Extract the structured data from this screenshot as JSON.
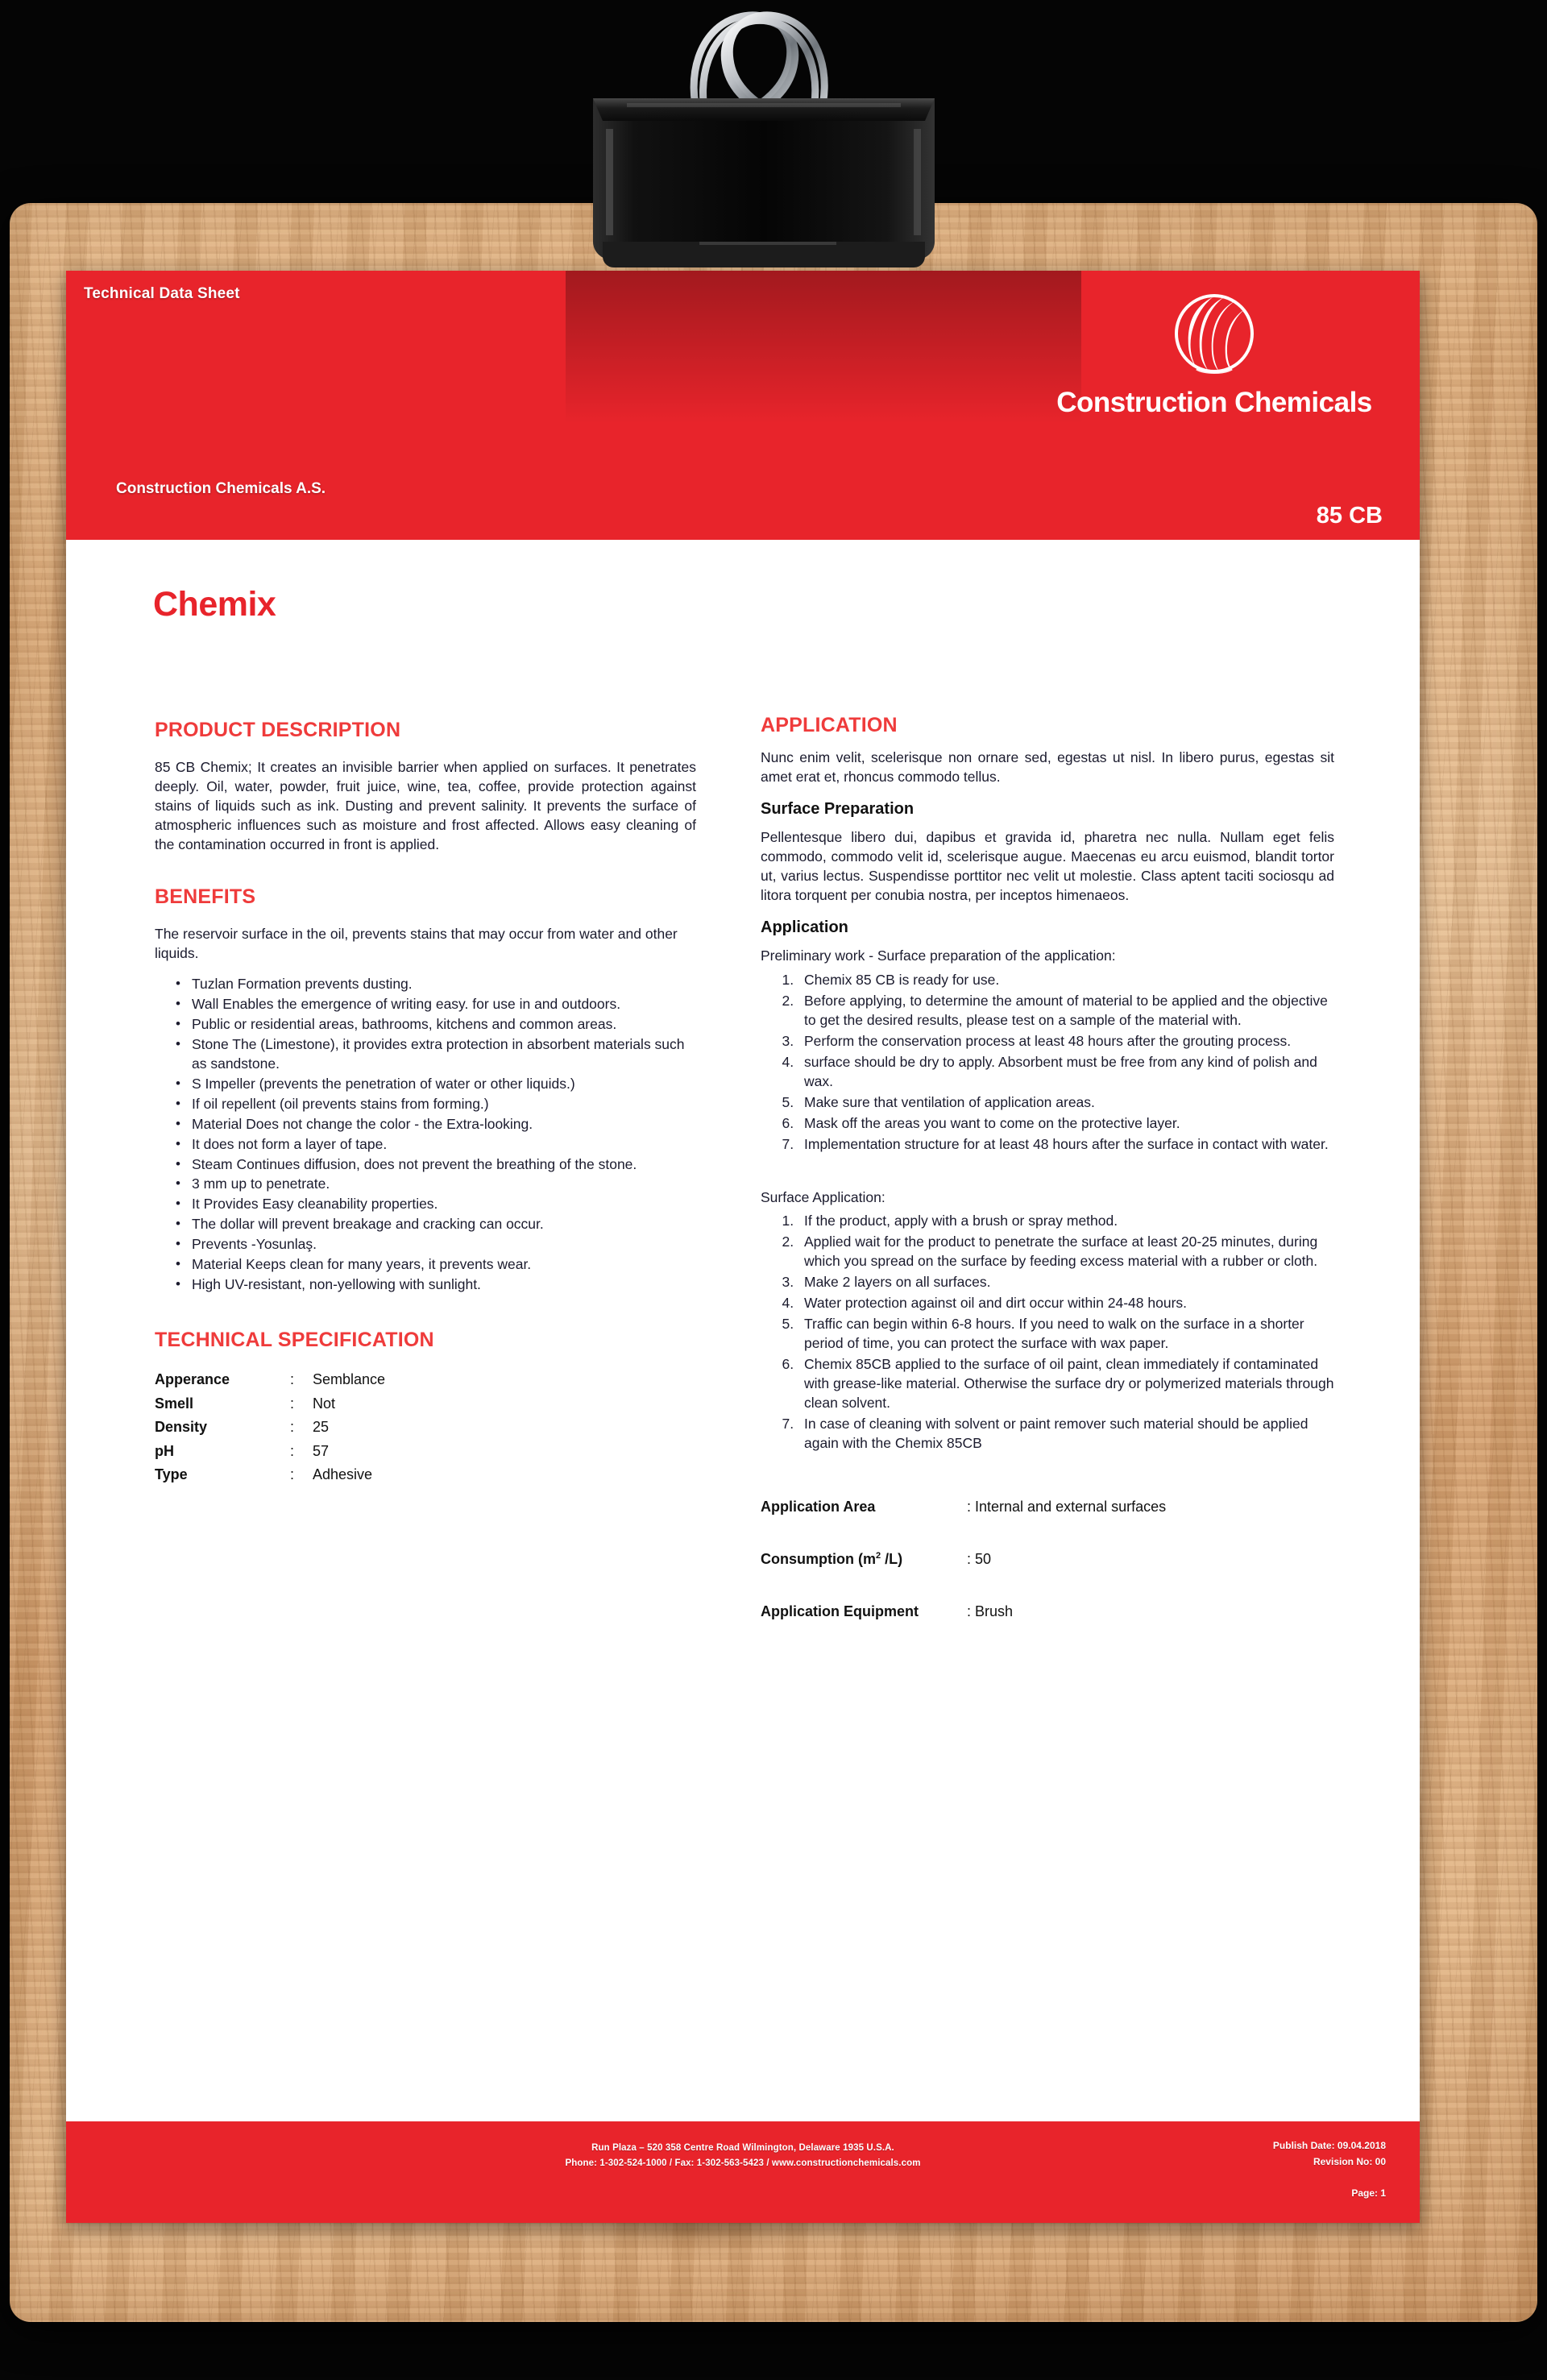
{
  "header": {
    "doc_label": "Technical Data Sheet",
    "company": "Construction Chemicals A.S.",
    "brand_name": "Construction Chemicals",
    "logo_icon": "globe-sphere-icon",
    "product_code": "85 CB"
  },
  "document": {
    "title": "Chemix"
  },
  "product_description": {
    "heading": "PRODUCT DESCRIPTION",
    "body": "85 CB Chemix; It creates an invisible barrier when applied on surfaces. It penetrates deeply. Oil, water, powder, fruit juice, wine, tea, coffee, provide protection against stains of liquids such as ink. Dusting and prevent salinity. It prevents the surface of atmospheric influences such as moisture and frost affected. Allows easy cleaning of the contamination occurred in front is applied."
  },
  "benefits": {
    "heading": "BENEFITS",
    "intro": "The reservoir surface in the oil, prevents stains that may occur from water and other liquids.",
    "items": [
      "Tuzlan Formation prevents dusting.",
      "Wall Enables the emergence of writing easy. for use in and outdoors.",
      "Public or residential areas, bathrooms, kitchens and common areas.",
      "Stone The (Limestone), it provides extra protection in absorbent materials such as sandstone.",
      "S Impeller (prevents the penetration of water or other liquids.)",
      "If oil repellent (oil prevents stains from forming.)",
      "Material Does not change the color - the Extra-looking.",
      "It does not form a layer of tape.",
      "Steam Continues diffusion, does not prevent the breathing of the stone.",
      "3 mm up to penetrate.",
      "It Provides Easy cleanability properties.",
      "The dollar will prevent breakage and cracking can occur.",
      "Prevents -Yosunlaş.",
      "Material Keeps clean for many years, it prevents wear.",
      "High UV-resistant, non-yellowing with sunlight."
    ]
  },
  "technical_specification": {
    "heading": "TECHNICAL SPECIFICATION",
    "rows": [
      {
        "key": "Apperance",
        "sep": ":",
        "value": "Semblance"
      },
      {
        "key": "Smell",
        "sep": ":",
        "value": "Not"
      },
      {
        "key": "Density",
        "sep": ":",
        "value": "25"
      },
      {
        "key": "pH",
        "sep": ":",
        "value": "57"
      },
      {
        "key": "Type",
        "sep": ":",
        "value": "Adhesive"
      }
    ]
  },
  "application": {
    "heading": "APPLICATION",
    "intro": "Nunc enim velit, scelerisque non ornare sed, egestas ut nisl. In libero purus, egestas sit amet erat et, rhoncus commodo tellus.",
    "surface_preparation": {
      "heading": "Surface Preparation",
      "body": "Pellentesque libero dui, dapibus et gravida id, pharetra nec nulla. Nullam eget felis commodo, commodo velit id, scelerisque augue. Maecenas eu arcu euismod, blandit tortor ut, varius lectus. Suspendisse porttitor nec velit ut molestie. Class aptent taciti sociosqu ad litora torquent per conubia nostra, per inceptos himenaeos."
    },
    "application_steps": {
      "heading": "Application",
      "lead": "Preliminary work - Surface preparation of the application:",
      "items": [
        "Chemix 85 CB is ready for use.",
        "Before applying, to determine the amount of material to be applied and the objective to get the desired results, please test on a sample of the material with.",
        "Perform the conservation process at least 48 hours after the grouting process.",
        "surface should be dry to apply. Absorbent must be free from any kind of polish and wax.",
        "Make sure that ventilation of application areas.",
        "Mask off the areas you want to come on the protective layer.",
        "Implementation structure for at least 48 hours after the surface in contact with water."
      ]
    },
    "surface_application": {
      "lead": "Surface Application:",
      "items": [
        "If the product, apply with a brush or spray method.",
        "Applied wait for the product to penetrate the surface at least 20-25 minutes, during which you spread on the surface by feeding excess material with a rubber or cloth.",
        "Make 2 layers on all surfaces.",
        "Water protection against oil and dirt occur within 24-48 hours.",
        "Traffic can begin within 6-8 hours. If you need to walk on the surface in a shorter period of time, you can protect the surface with wax paper.",
        "Chemix 85CB applied to the surface of oil paint, clean immediately if contaminated with grease-like material. Otherwise the surface dry or polymerized materials through clean solvent.",
        "In case of cleaning with solvent or paint remover such material should be applied again with the Chemix 85CB"
      ]
    },
    "info_rows": [
      {
        "key": "Application Area",
        "sep": ":",
        "value": "Internal and external surfaces"
      },
      {
        "key": "Consumption (m2 /L)",
        "sep": ":",
        "value": "50"
      },
      {
        "key": "Application Equipment",
        "sep": ":",
        "value": "Brush"
      }
    ]
  },
  "footer": {
    "address_line1": "Run Plaza – 520 358 Centre Road Wilmington, Delaware 1935 U.S.A.",
    "address_line2": "Phone: 1-302-524-1000 / Fax: 1-302-563-5423 / www.constructionchemicals.com",
    "publish_date": "Publish Date: 09.04.2018",
    "revision": "Revision No: 00",
    "page": "Page: 1"
  },
  "colors": {
    "brand_red": "#e8242b",
    "heading_red": "#ef3b3b",
    "body_text": "#1b1b2e",
    "paper": "#ffffff"
  }
}
